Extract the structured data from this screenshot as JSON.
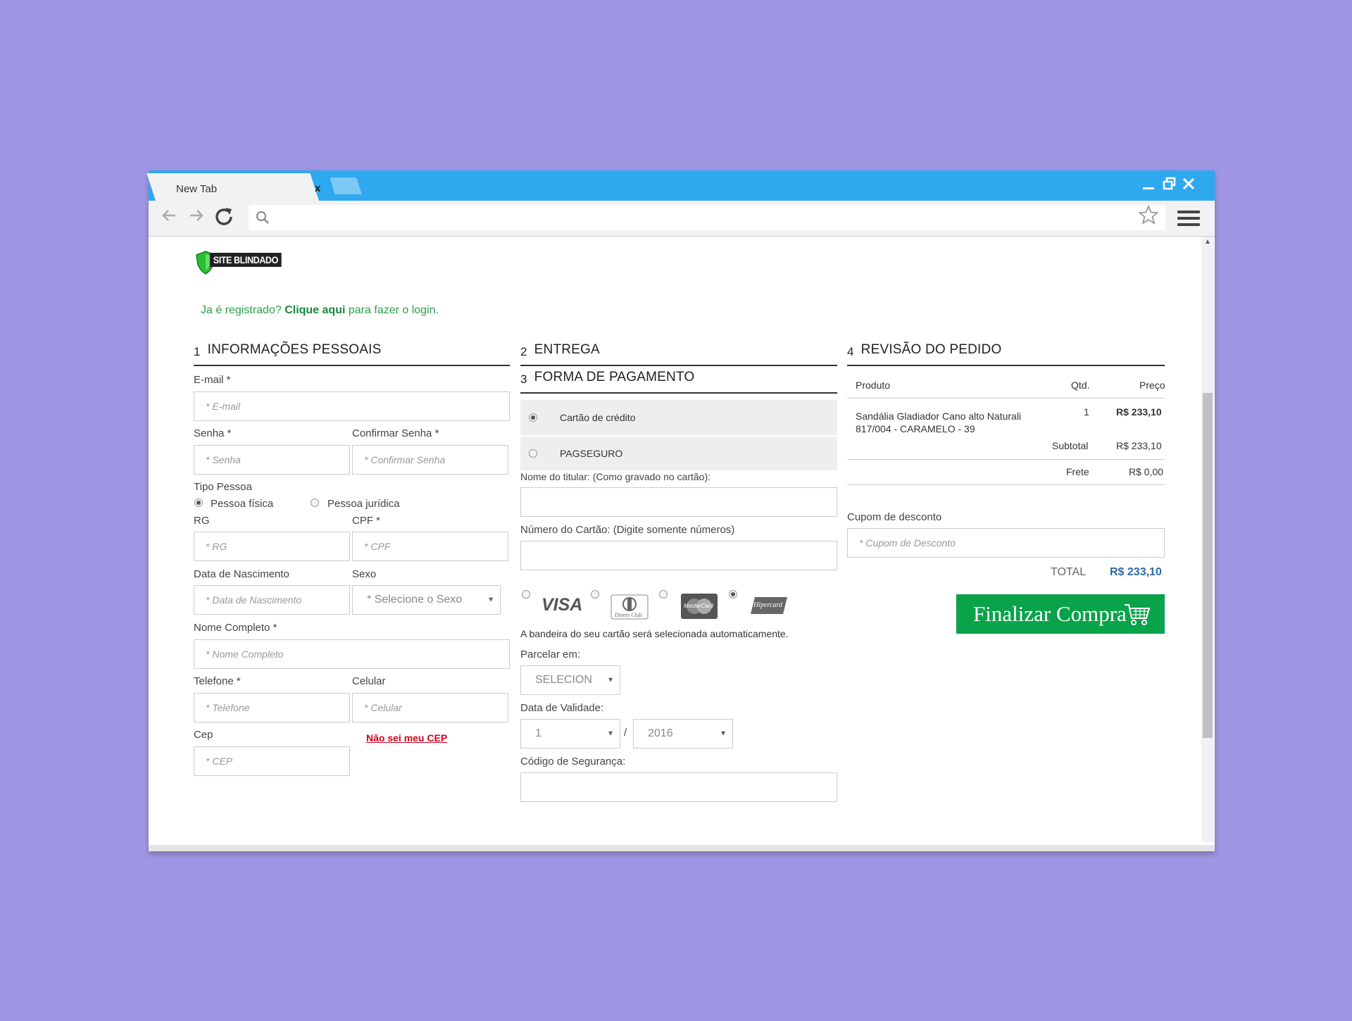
{
  "browser": {
    "tab_title": "New Tab",
    "tab_close": "x",
    "url_value": ""
  },
  "page": {
    "logo_text": "SITE BLINDADO",
    "login": {
      "prefix": "Ja é registrado?",
      "link": "Clique aqui",
      "suffix": "para fazer o login."
    },
    "section1": {
      "number": "1",
      "title": "INFORMAÇÕES PESSOAIS",
      "email_label": "E-mail *",
      "email_placeholder": "* E-mail",
      "senha_label": "Senha *",
      "senha_placeholder": "* Senha",
      "confirmar_label": "Confirmar Senha *",
      "confirmar_placeholder": "* Confirmar Senha",
      "tipo_label": "Tipo Pessoa",
      "pessoa_fisica": "Pessoa física",
      "pessoa_juridica": "Pessoa jurídica",
      "rg_label": "RG",
      "rg_placeholder": "* RG",
      "cpf_label": "CPF *",
      "cpf_placeholder": "* CPF",
      "nascimento_label": "Data de Nascimento",
      "nascimento_placeholder": "* Data de Nascimento",
      "sexo_label": "Sexo",
      "sexo_selected": "* Selecione o Sexo",
      "nome_label": "Nome Completo *",
      "nome_placeholder": "* Nome Completo",
      "telefone_label": "Telefone *",
      "telefone_placeholder": "* Telefone",
      "celular_label": "Celular",
      "celular_placeholder": "* Celular",
      "cep_label": "Cep",
      "cep_placeholder": "* CEP",
      "nao_sei_cep": "Não sei meu CEP"
    },
    "section2": {
      "number": "2",
      "title": "ENTREGA"
    },
    "section3": {
      "number": "3",
      "title": "FORMA DE PAGAMENTO",
      "option_cartao": "Cartão de crédito",
      "option_pagseguro": "PAGSEGURO",
      "titular_label": "Nome do titular: (Como gravado no cartão):",
      "numero_label": "Número do Cartão: (Digite somente números)",
      "card_brands": [
        "VISA",
        "Diners Club",
        "MasterCard",
        "Hipercard"
      ],
      "bandeira_note": "A bandeira do seu cartão será selecionada automaticamente.",
      "parcelar_label": "Parcelar em:",
      "parcelar_selected": "SELECION",
      "validade_label": "Data de Validade:",
      "validade_mes": "1",
      "validade_sep": "/",
      "validade_ano": "2016",
      "seguranca_label": "Código de Segurança:"
    },
    "section4": {
      "number": "4",
      "title": "REVISÃO DO PEDIDO",
      "col_produto": "Produto",
      "col_qtd": "Qtd.",
      "col_preco": "Preço",
      "item_name_line1": "Sandália Gladiador Cano alto Naturali",
      "item_name_line2": "817/004 - CARAMELO - 39",
      "item_qtd": "1",
      "item_preco": "R$ 233,10",
      "subtotal_label": "Subtotal",
      "subtotal_value": "R$ 233,10",
      "frete_label": "Frete",
      "frete_value": "R$ 0,00",
      "cupom_label": "Cupom de desconto",
      "cupom_placeholder": "* Cupom de Desconto",
      "total_label": "TOTAL",
      "total_value": "R$ 233,10",
      "finalizar_label": "Finalizar Compra"
    }
  },
  "colors": {
    "background": "#9f97e3",
    "titlebar": "#2ea9f0",
    "brand_green": "#0aa34a",
    "link_red": "#d0021b",
    "total_blue": "#2a6aa8"
  }
}
